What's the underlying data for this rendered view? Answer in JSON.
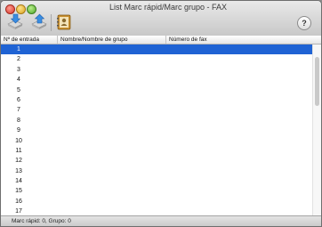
{
  "window": {
    "title": "List Marc rápid/Marc grupo - FAX",
    "help_label": "?"
  },
  "toolbar": {
    "tools": [
      {
        "icon": "import-icon"
      },
      {
        "icon": "export-icon"
      },
      {
        "icon": "address-book-icon"
      }
    ]
  },
  "table": {
    "columns": [
      "Nº de entrada",
      "Nombre/Nombre de grupo",
      "Número de fax"
    ],
    "rows": [
      "1",
      "2",
      "3",
      "4",
      "5",
      "6",
      "7",
      "8",
      "9",
      "10",
      "11",
      "12",
      "13",
      "14",
      "15",
      "16",
      "17"
    ],
    "selected_index": 0
  },
  "status": {
    "text": "Marc rápid: 0, Grupo: 0"
  },
  "colors": {
    "selection": "#1f63d4"
  }
}
